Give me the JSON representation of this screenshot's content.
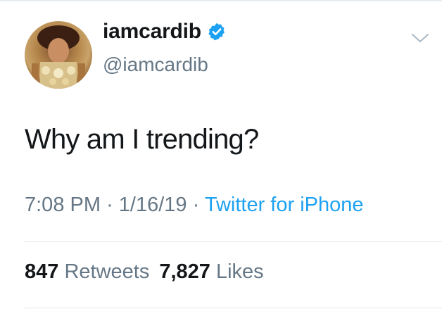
{
  "author": {
    "display_name": "iamcardib",
    "handle": "@iamcardib",
    "verified": true
  },
  "tweet": {
    "text": "Why am I trending?",
    "time": "7:08 PM",
    "separator": "·",
    "date": "1/16/19",
    "source": "Twitter for iPhone"
  },
  "stats": {
    "retweets_count": "847",
    "retweets_label": "Retweets",
    "likes_count": "7,827",
    "likes_label": "Likes"
  },
  "icons": {
    "verified": "verified-badge-icon",
    "menu": "chevron-down-icon"
  },
  "colors": {
    "text": "#14171a",
    "secondary": "#657786",
    "accent": "#1da1f2",
    "divider": "#e1e8ed"
  }
}
